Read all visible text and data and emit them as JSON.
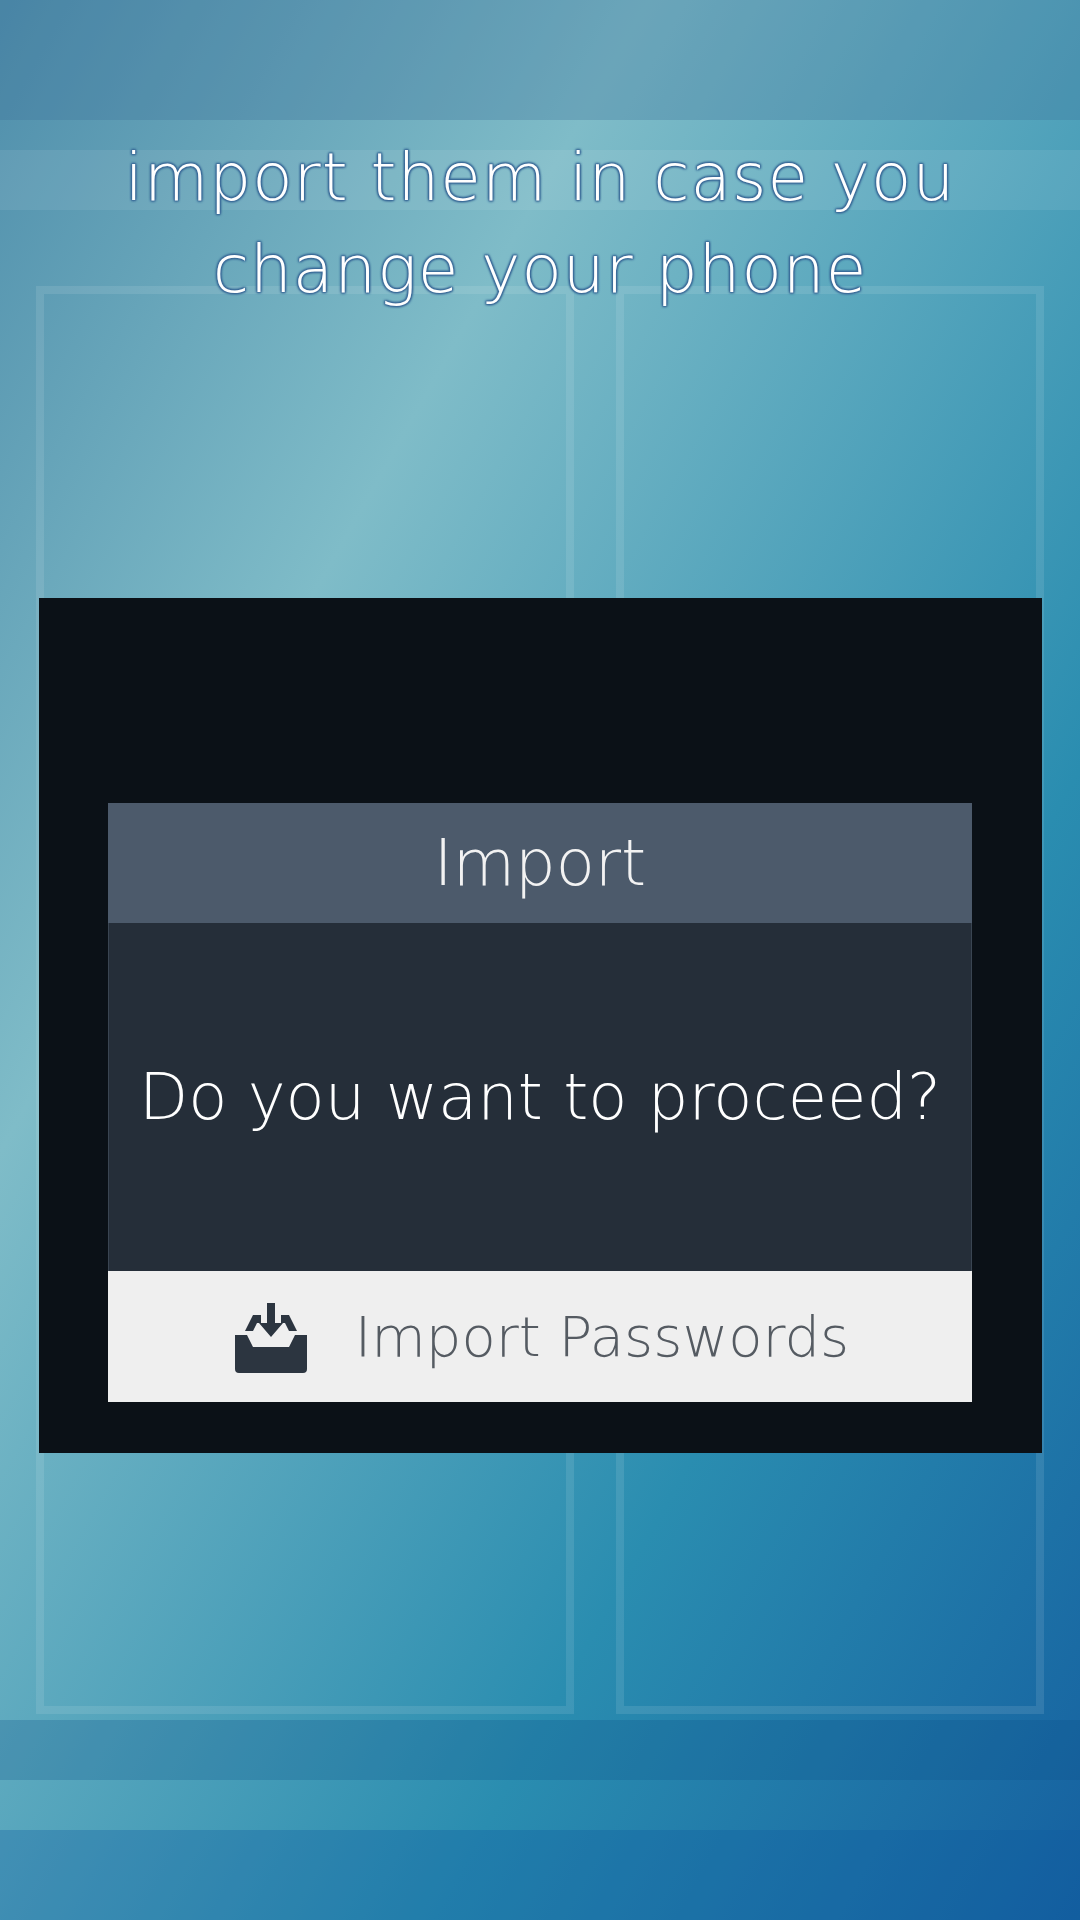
{
  "headline": "import them in case you change your phone",
  "dialog": {
    "title": "Import",
    "message": "Do you want to proceed?",
    "button": {
      "label": "Import Passwords"
    }
  }
}
